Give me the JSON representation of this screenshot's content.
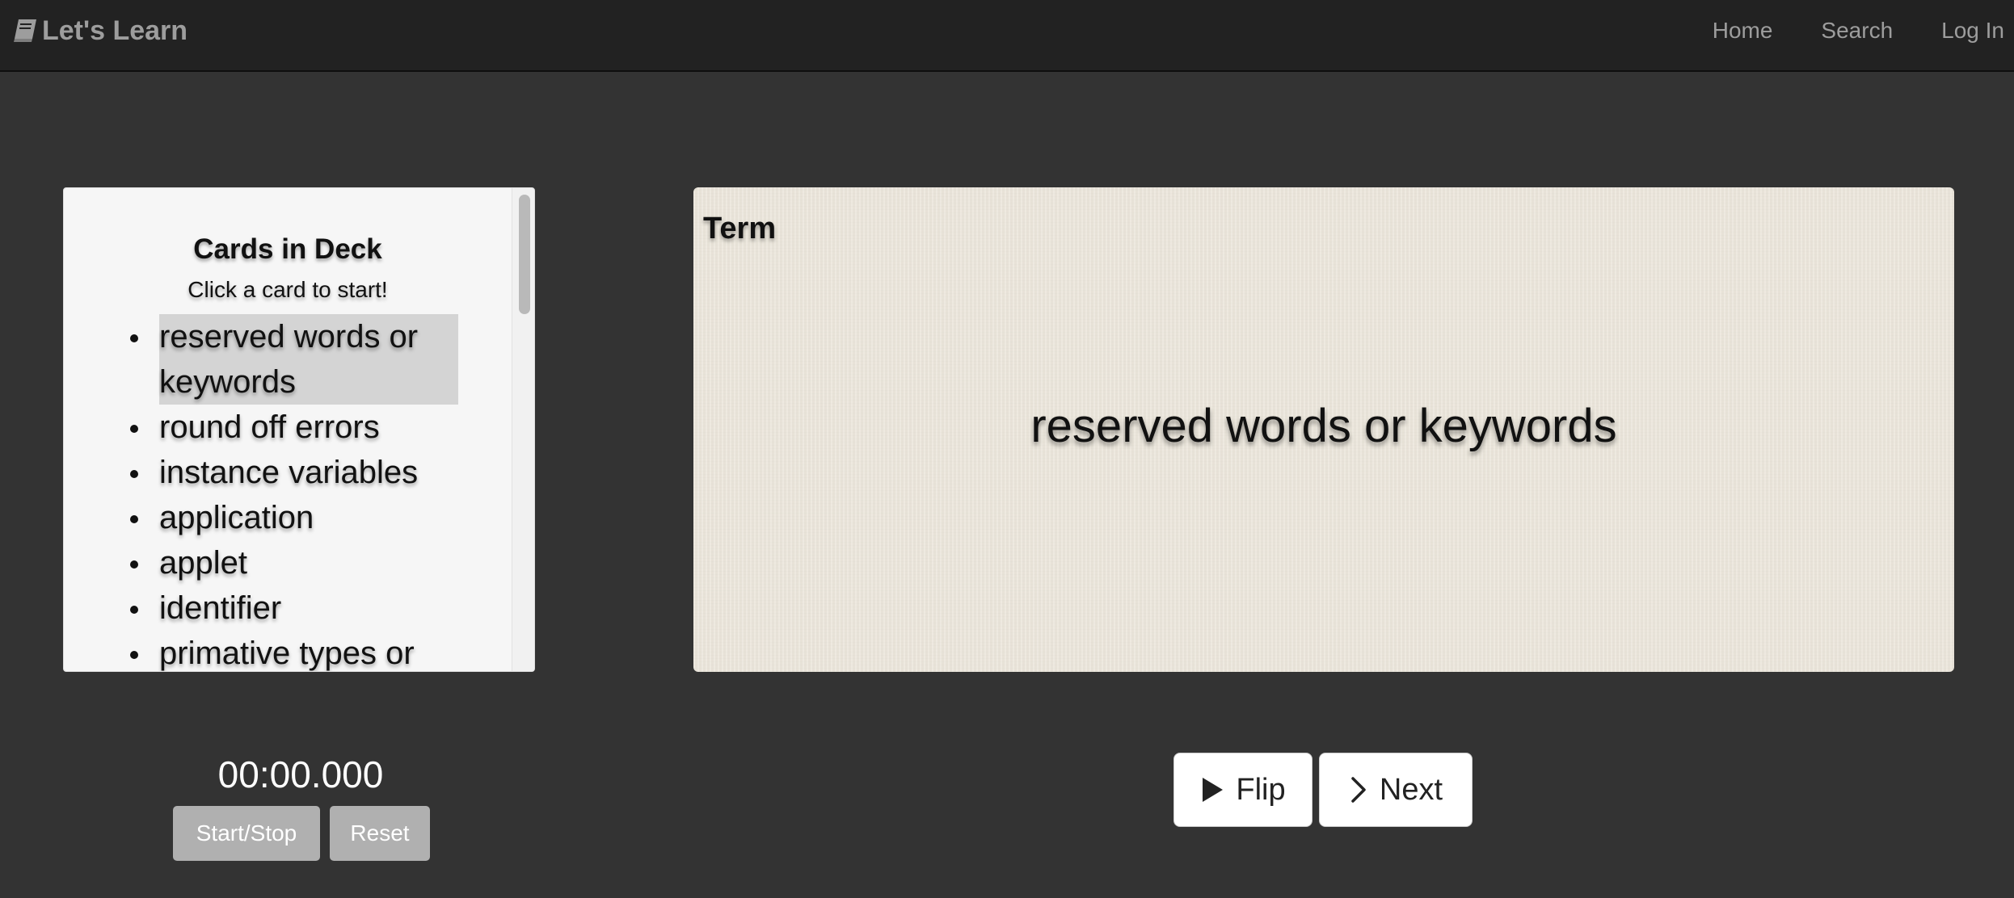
{
  "navbar": {
    "brand_label": "Let's Learn",
    "brand_icon": "book-icon",
    "links": [
      "Home",
      "Search",
      "Log In"
    ]
  },
  "deck": {
    "title": "Cards in Deck",
    "subtitle": "Click a card to start!",
    "cards": [
      "reserved words or keywords",
      "round off errors",
      "instance variables",
      "application",
      "applet",
      "identifier",
      "primative types or"
    ],
    "selected_index": 0
  },
  "flashcard": {
    "side_label": "Term",
    "text": "reserved words or keywords"
  },
  "timer": {
    "display": "00:00.000",
    "start_stop_label": "Start/Stop",
    "reset_label": "Reset"
  },
  "controls": {
    "flip_label": "Flip",
    "flip_icon": "play-icon",
    "next_label": "Next",
    "next_icon": "chevron-right-icon"
  },
  "colors": {
    "navbar_bg": "#222222",
    "page_bg": "#333333",
    "card_bg": "#ece7dc",
    "selected_item_bg": "#d4d4d4",
    "timer_button_bg": "#b0b0b0"
  }
}
